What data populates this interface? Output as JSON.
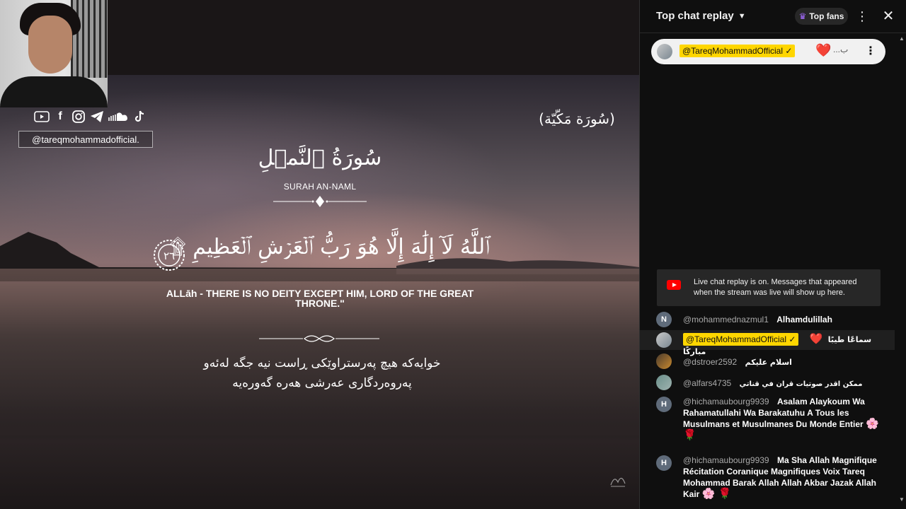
{
  "video": {
    "channel_handle": "@tareqmohammadofficial.",
    "social_icons": [
      "youtube-icon",
      "facebook-icon",
      "instagram-icon",
      "telegram-icon",
      "soundcloud-icon",
      "tiktok-icon"
    ],
    "meccan_label": "(سُورَة مَكّيّة)",
    "surah_arabic": "سُورَةُ ٱلنَّمۡلِ",
    "surah_english": "SURAH AN-NAML",
    "verse_number": "٢٦",
    "verse_arabic": "ٱللَّهُ لَآ إِلَٰهَ إِلَّا هُوَ رَبُّ ٱلۡعَرۡشِ ٱلۡعَظِيمِ ۩",
    "verse_english": "ALLāh - THERE IS NO DEITY EXCEPT HIM, LORD OF THE GREAT THRONE.\"",
    "verse_kurdish_line1": "خوایەکە هیچ پەرستراوێکی ڕاست نیە جگە لەئەو",
    "verse_kurdish_line2": "پەروەردگاری عەرشی هەرە گەورەیە"
  },
  "chat": {
    "title": "Top chat replay",
    "top_fans_label": "Top fans",
    "pinned": {
      "author": "@TareqMohammadOfficial ✓",
      "heart": "❤️",
      "trailing": "...ب"
    },
    "notice": "Live chat replay is on. Messages that appeared when the stream was live will show up here.",
    "messages": [
      {
        "avatar": "N",
        "author": "@mohammednazmul1",
        "text": "Alhamdulillah"
      },
      {
        "avatar": "",
        "author": "@TareqMohammadOfficial ✓",
        "heart": "❤️",
        "text": "سماعًا طيبًا مباركًا"
      },
      {
        "avatar": "",
        "author": "@dstroer2592",
        "text": "اسلام عليكم"
      },
      {
        "avatar": "",
        "author": "@alfars4735",
        "text": "ممكن اقدر صوتيات قران في قناتي"
      },
      {
        "avatar": "H",
        "author": "@hichamaubourg9939",
        "text": "Asalam Alaykoum Wa Rahamatullahi Wa Barakatuhu A Tous les Musulmans et Musulmanes Du Monde Entier",
        "emoji": "🌸 🌹"
      },
      {
        "avatar": "H",
        "author": "@hichamaubourg9939",
        "text": "Ma Sha Allah Magnifique Récitation Coranique Magnifiques Voix Tareq Mohammad Barak Allah Allah Akbar Jazak Allah Kair",
        "emoji": "🌸 🌹"
      }
    ]
  },
  "colors": {
    "chat_bg": "#0f0f0f",
    "owner_badge": "#ffd600",
    "youtube_red": "#ff0000",
    "heart": "#e0244a"
  }
}
